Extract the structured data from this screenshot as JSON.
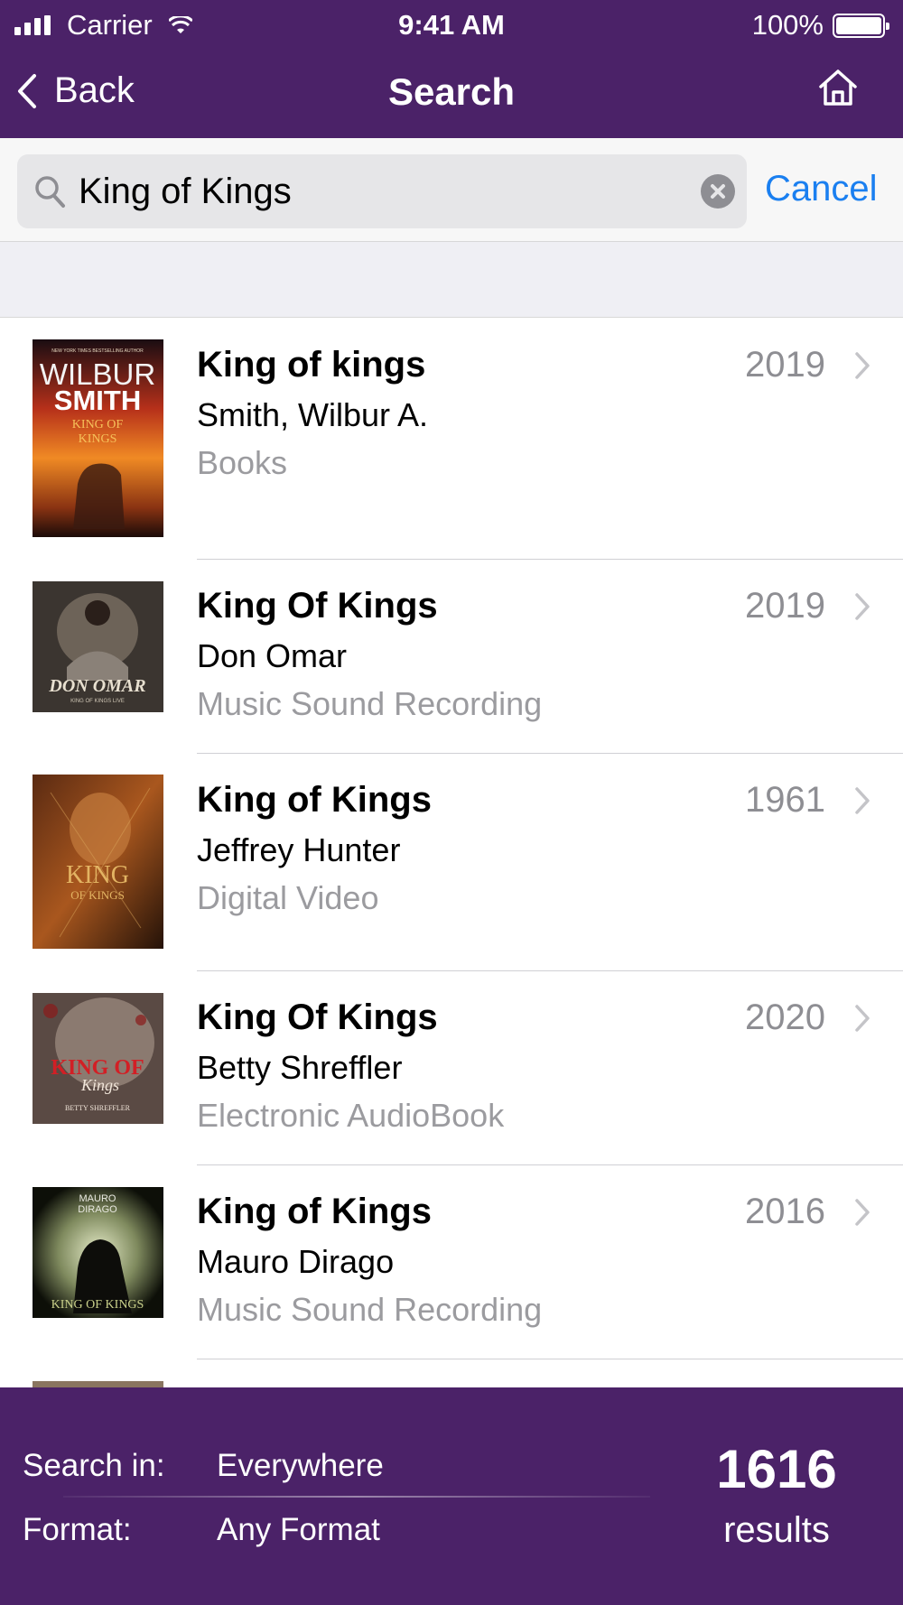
{
  "status_bar": {
    "carrier": "Carrier",
    "time": "9:41 AM",
    "battery": "100%"
  },
  "nav": {
    "back_label": "Back",
    "title": "Search"
  },
  "search": {
    "query": "King of Kings",
    "cancel_label": "Cancel"
  },
  "results": [
    {
      "title": "King of kings",
      "year": "2019",
      "author": "Smith, Wilbur A.",
      "format": "Books",
      "cover_text": [
        "NEW YORK TIMES BESTSELLING AUTHOR",
        "WILBUR",
        "SMITH",
        "KING OF",
        "KINGS"
      ]
    },
    {
      "title": "King Of Kings",
      "year": "2019",
      "author": "Don Omar",
      "format": "Music Sound Recording",
      "cover_text": [
        "DON OMAR",
        "KING OF KINGS LIVE"
      ]
    },
    {
      "title": "King of Kings",
      "year": "1961",
      "author": "Jeffrey Hunter",
      "format": "Digital Video",
      "cover_text": [
        "KING",
        "OF KINGS"
      ]
    },
    {
      "title": "King Of Kings",
      "year": "2020",
      "author": "Betty Shreffler",
      "format": "Electronic AudioBook",
      "cover_text": [
        "KING OF",
        "Kings",
        "BETTY SHREFFLER"
      ]
    },
    {
      "title": "King of Kings",
      "year": "2016",
      "author": "Mauro Dirago",
      "format": "Music Sound Recording",
      "cover_text": [
        "MAURO",
        "DIRAGO",
        "KING OF KINGS"
      ]
    }
  ],
  "footer": {
    "search_in_label": "Search in:",
    "search_in_value": "Everywhere",
    "format_label": "Format:",
    "format_value": "Any Format",
    "count": "1616",
    "count_label": "results"
  },
  "colors": {
    "header": "#4b2268",
    "link": "#1a7ff0",
    "secondary_text": "#8e8e93"
  },
  "icons": [
    "signal-icon",
    "wifi-icon",
    "battery-icon",
    "back-chevron-icon",
    "home-icon",
    "search-icon",
    "clear-icon",
    "chevron-right-icon"
  ]
}
